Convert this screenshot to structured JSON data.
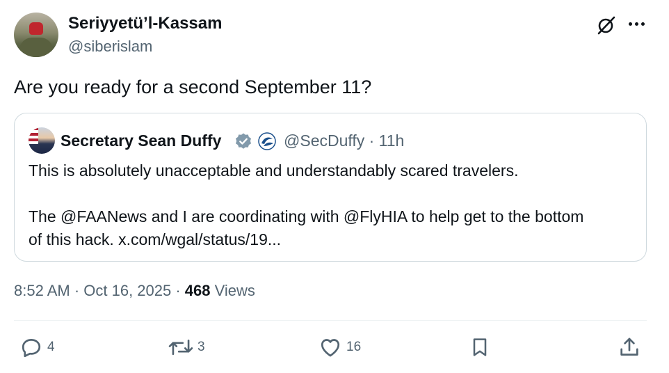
{
  "author": {
    "name": "Seriyyetü’l-Kassam",
    "handle": "@siberislam"
  },
  "tweet": {
    "text": "Are you ready for a second September 11?"
  },
  "quoted": {
    "name": "Secretary Sean Duffy",
    "handle_time": "@SecDuffy · 11h",
    "line1": "This is absolutely unacceptable and understandably scared travelers.",
    "line2": "The @FAANews and I are coordinating with @FlyHIA to help get to the bottom",
    "line3": "of this hack. x.com/wgal/status/19..."
  },
  "meta": {
    "timestamp": "8:52 AM · Oct 16, 2025 · ",
    "views_count": "468",
    "views_label": " Views"
  },
  "actions": {
    "replies": "4",
    "reposts": "3",
    "likes": "16"
  },
  "icons": {
    "grok": "grok-icon",
    "more": "more-icon",
    "verified": "verified-badge-icon",
    "affiliate": "dot-logo-icon",
    "reply": "reply-icon",
    "repost": "repost-icon",
    "like": "heart-icon",
    "bookmark": "bookmark-icon",
    "share": "share-icon"
  },
  "colors": {
    "text": "#0f1419",
    "secondary": "#536471",
    "border": "#cfd9de",
    "verified": "#829aab",
    "dot_blue": "#1a4f8b"
  }
}
